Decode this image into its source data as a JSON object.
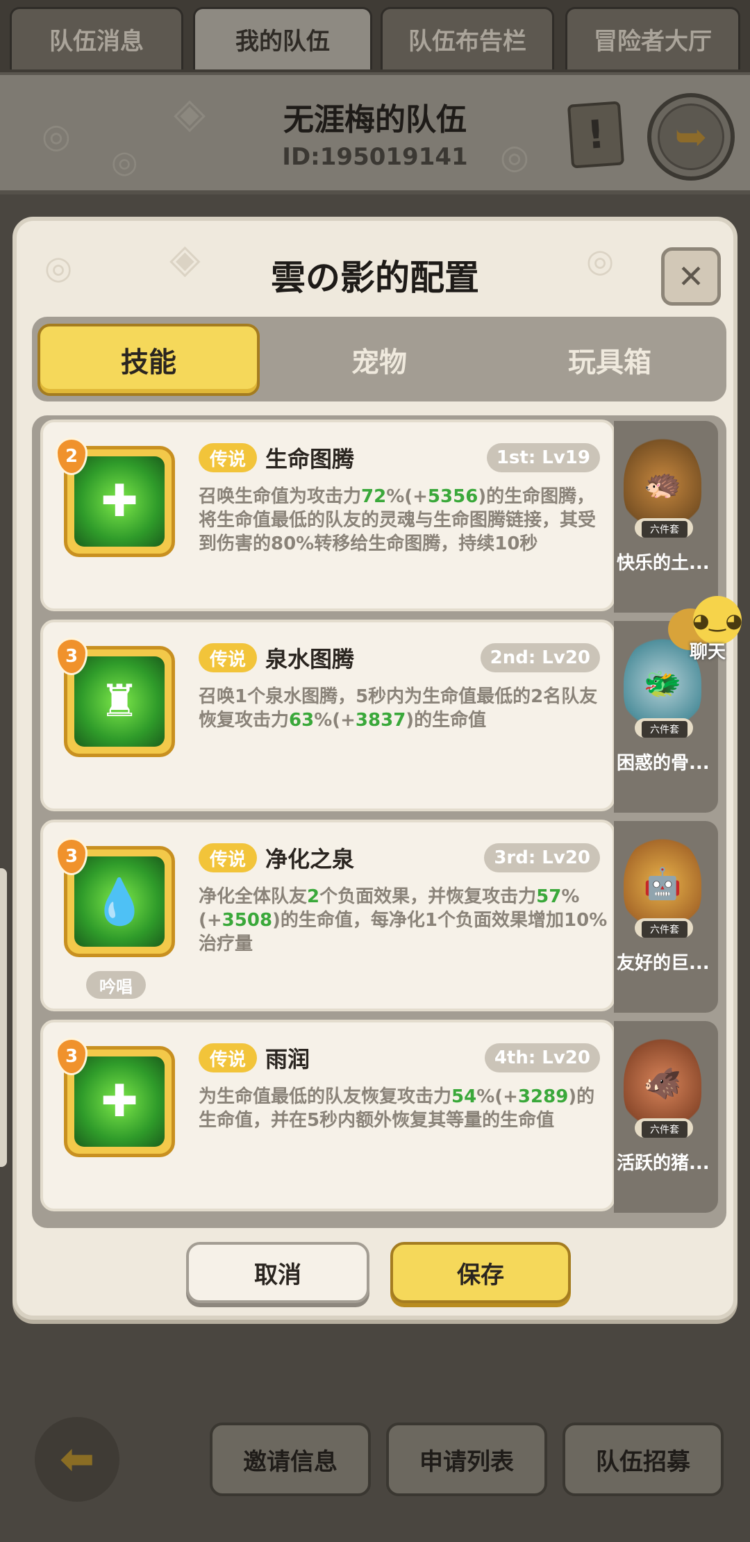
{
  "top_tabs": [
    {
      "label": "队伍消息",
      "active": false
    },
    {
      "label": "我的队伍",
      "active": true
    },
    {
      "label": "队伍布告栏",
      "active": false
    },
    {
      "label": "冒险者大厅",
      "active": false
    }
  ],
  "header": {
    "team_name": "无涯梅的队伍",
    "team_id": "ID:195019141"
  },
  "dialog": {
    "title": "雲の影的配置",
    "close_glyph": "✕",
    "tabs": [
      {
        "label": "技能",
        "active": true
      },
      {
        "label": "宠物",
        "active": false
      },
      {
        "label": "玩具箱",
        "active": false
      }
    ],
    "skills": [
      {
        "level": "2",
        "rarity": "传说",
        "name": "生命图腾",
        "slot": "1st: Lv19",
        "icon": "totem-icon",
        "desc_parts": [
          "召唤生命值为攻击力",
          "72",
          "%(+",
          "5356",
          ")的生命图腾，将生命值最低的队友的灵魂与生命图腾链接，其受到伤害的80%转移给生命图腾，持续10秒"
        ],
        "chant": "",
        "pet_name": "快乐的土...",
        "pet_set": "六件套"
      },
      {
        "level": "3",
        "rarity": "传说",
        "name": "泉水图腾",
        "slot": "2nd: Lv20",
        "icon": "spring-totem-icon",
        "desc_parts": [
          "召唤1个泉水图腾，5秒内为生命值最低的2名队友恢复攻击力",
          "63",
          "%(+",
          "3837",
          ")的生命值"
        ],
        "chant": "",
        "pet_name": "困惑的骨...",
        "pet_set": "六件套"
      },
      {
        "level": "3",
        "rarity": "传说",
        "name": "净化之泉",
        "slot": "3rd: Lv20",
        "icon": "purify-spring-icon",
        "desc_parts": [
          "净化全体队友",
          "2",
          "个负面效果，并恢复攻击力",
          "57",
          "%(+",
          "3508",
          ")的生命值，每净化1个负面效果增加10%治疗量"
        ],
        "chant": "吟唱",
        "pet_name": "友好的巨...",
        "pet_set": "六件套"
      },
      {
        "level": "3",
        "rarity": "传说",
        "name": "雨润",
        "slot": "4th: Lv20",
        "icon": "rain-heal-icon",
        "desc_parts": [
          "为生命值最低的队友恢复攻击力",
          "54",
          "%(+",
          "3289",
          ")的生命值，并在5秒内额外恢复其等量的生命值"
        ],
        "chant": "",
        "pet_name": "活跃的猪...",
        "pet_set": "六件套"
      }
    ],
    "chat_label": "聊天",
    "cancel_label": "取消",
    "save_label": "保存"
  },
  "bottom_buttons": [
    "邀请信息",
    "申请列表",
    "队伍招募"
  ],
  "colors": {
    "accent_yellow": "#f5d85a",
    "highlight_green": "#3aa83a",
    "rarity_gold": "#f2c43a"
  }
}
